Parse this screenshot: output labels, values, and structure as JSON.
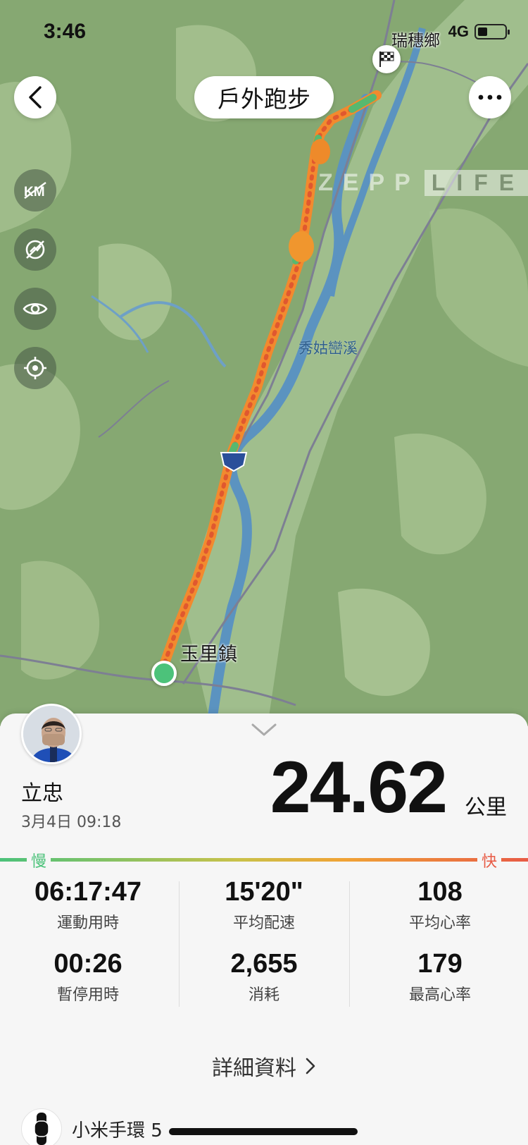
{
  "status_bar": {
    "time": "3:46",
    "network": "4G",
    "battery_level": 0.35
  },
  "header": {
    "title": "戶外跑步",
    "back_icon": "chevron-left-icon",
    "more_icon": "ellipsis-icon"
  },
  "map": {
    "tools": [
      "km-marker-icon",
      "hide-pace-icon",
      "visibility-icon",
      "locate-icon"
    ],
    "labels": {
      "start_town": "玉里鎮",
      "end_town": "瑞穗鄉",
      "river": "秀姑巒溪"
    },
    "watermark": {
      "part1": "ZEPP",
      "part2": "LIFE"
    }
  },
  "summary": {
    "user_name": "立忠",
    "date": "3月4日 09:18",
    "distance": "24.62",
    "distance_unit": "公里",
    "pace_scale": {
      "slow": "慢",
      "fast": "快"
    },
    "stats": [
      {
        "value": "06:17:47",
        "label": "運動用時"
      },
      {
        "value": "15'20\"",
        "label": "平均配速"
      },
      {
        "value": "108",
        "label": "平均心率"
      },
      {
        "value": "00:26",
        "label": "暫停用時"
      },
      {
        "value": "2,655",
        "label": "消耗"
      },
      {
        "value": "179",
        "label": "最高心率"
      }
    ],
    "detail_link": "詳細資料",
    "device": "小米手環 5"
  },
  "colors": {
    "accent_slow": "#4cc27a",
    "accent_fast": "#e85b45",
    "route": "#f28a2e"
  }
}
